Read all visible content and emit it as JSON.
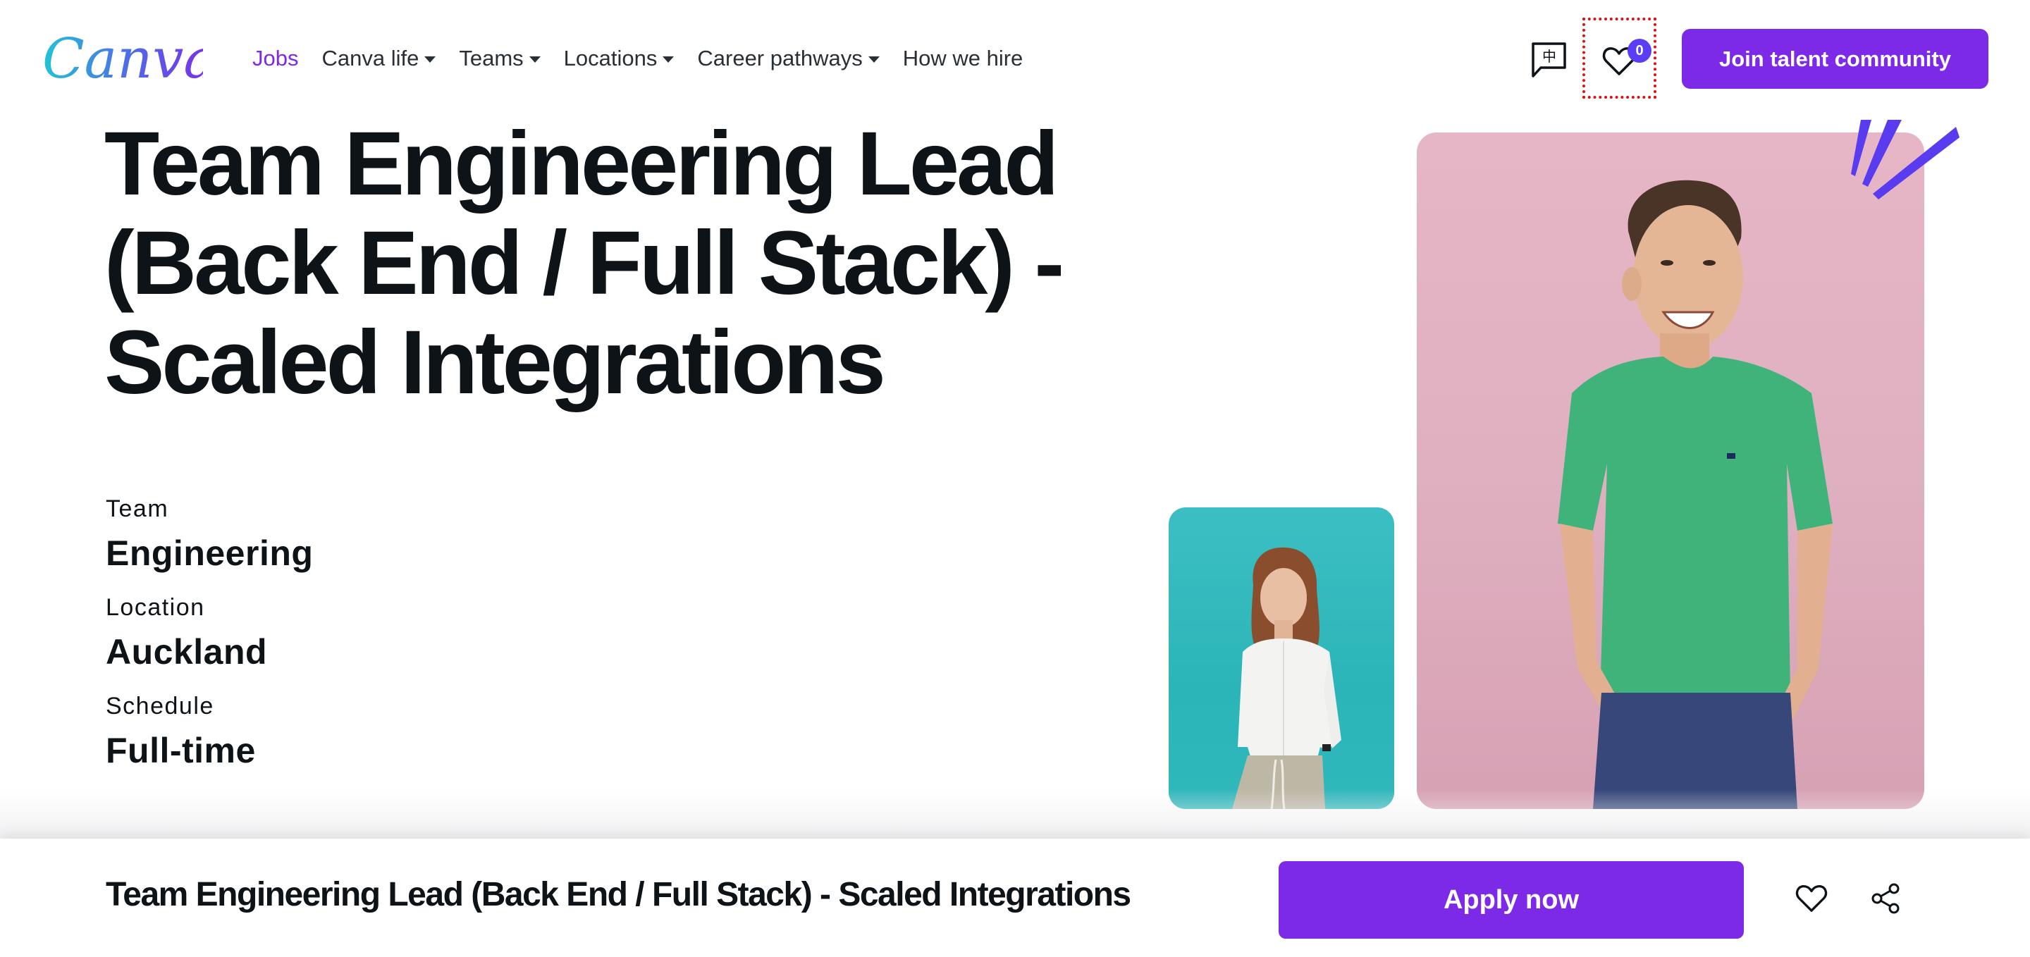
{
  "nav": {
    "logo_text": "Canva",
    "items": [
      {
        "label": "Jobs",
        "active": true,
        "dropdown": false
      },
      {
        "label": "Canva life",
        "active": false,
        "dropdown": true
      },
      {
        "label": "Teams",
        "active": false,
        "dropdown": true
      },
      {
        "label": "Locations",
        "active": false,
        "dropdown": true
      },
      {
        "label": "Career pathways",
        "active": false,
        "dropdown": true
      },
      {
        "label": "How we hire",
        "active": false,
        "dropdown": false
      }
    ],
    "language_glyph": "中",
    "favorites_count": "0",
    "join_button": "Join talent community"
  },
  "hero": {
    "title_lines": [
      "Team Engineering Lead",
      "(Back End / Full Stack) -",
      "Scaled Integrations"
    ],
    "details": [
      {
        "label": "Team",
        "value": "Engineering"
      },
      {
        "label": "Location",
        "value": "Auckland"
      },
      {
        "label": "Schedule",
        "value": "Full-time"
      }
    ]
  },
  "sticky_bar": {
    "title": "Team Engineering Lead (Back End / Full Stack) - Scaled Integrations",
    "apply_button": "Apply now"
  },
  "colors": {
    "brand_purple": "#7d2ae8",
    "badge_blue": "#5b3df5",
    "text_dark": "#0e1318",
    "focus_outline": "#e01010"
  }
}
